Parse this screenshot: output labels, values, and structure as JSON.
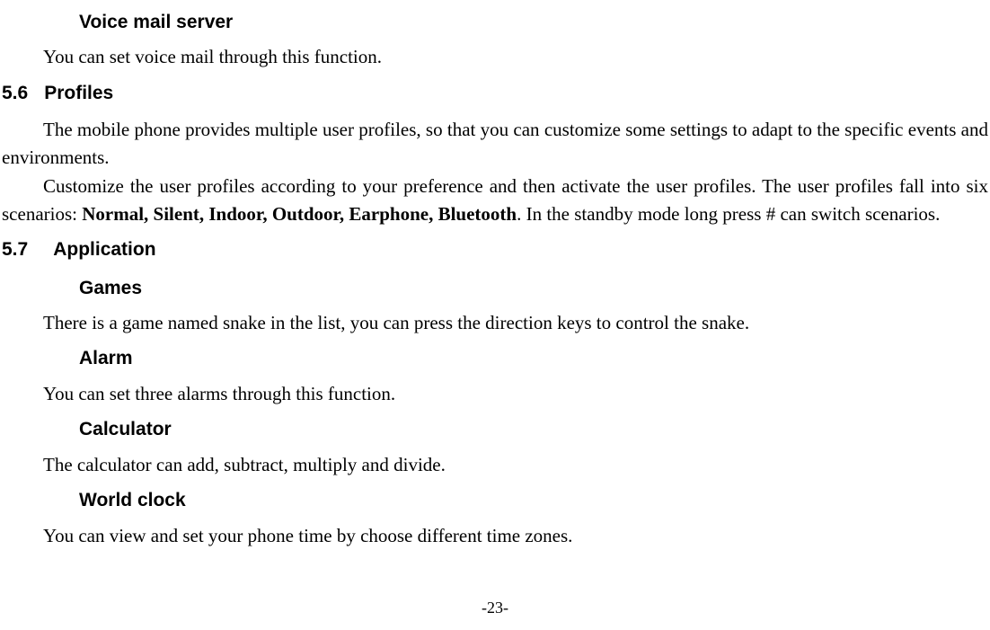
{
  "sections": {
    "voicemail": {
      "title": "Voice mail server",
      "body": "You can set voice mail through this function."
    },
    "profiles": {
      "number": "5.6",
      "title": "Profiles",
      "p1": "The mobile phone provides multiple user profiles, so that you can customize some settings to adapt to the specific events and environments.",
      "p2a": "Customize the user profiles according to your preference and then activate the user profiles. The user profiles fall into six scenarios: ",
      "p2b_bold": "Normal, Silent, Indoor, Outdoor, Earphone, Bluetooth",
      "p2c": ". In the standby mode long press # can switch scenarios."
    },
    "application": {
      "number": "5.7",
      "title": "Application",
      "games": {
        "title": "Games",
        "body": "There is a game named snake in the list, you can press the direction keys to control the snake."
      },
      "alarm": {
        "title": "Alarm",
        "body": "You can set three alarms through this function."
      },
      "calculator": {
        "title": "Calculator",
        "body": "The calculator can add, subtract, multiply and divide."
      },
      "worldclock": {
        "title": "World clock",
        "body": "You can view and set your phone time by choose different time zones."
      }
    }
  },
  "page_number": "-23-"
}
